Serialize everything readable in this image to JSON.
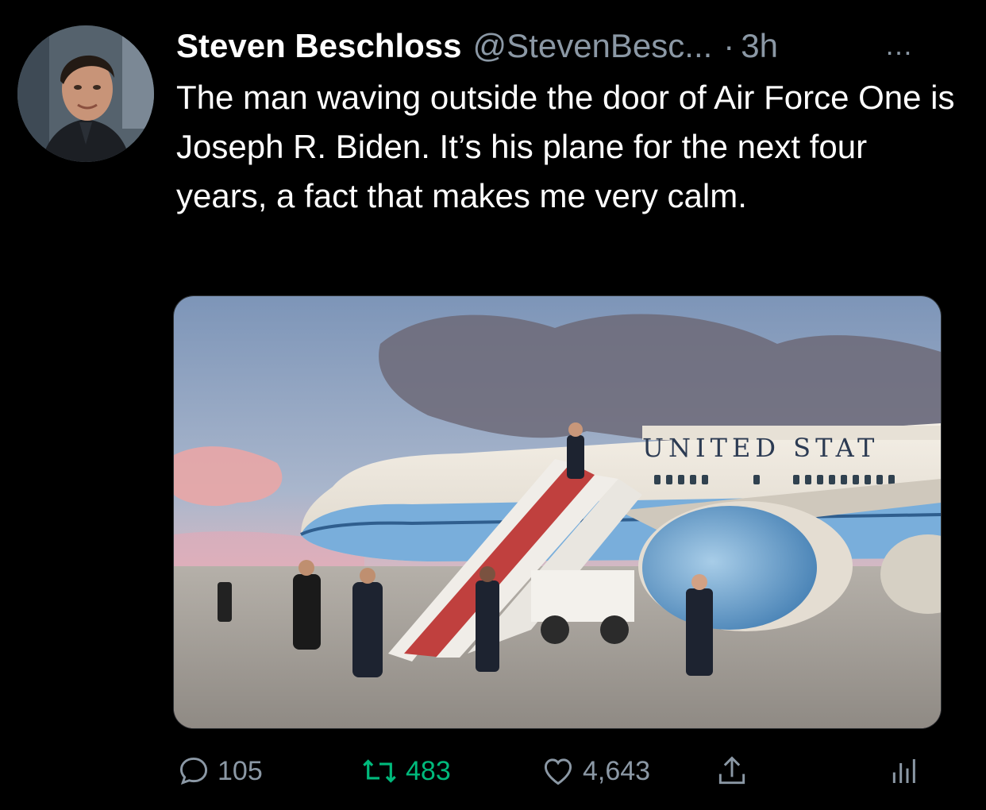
{
  "tweet": {
    "author_name": "Steven Beschloss",
    "handle": "@StevenBesc...",
    "separator": "·",
    "time": "3h",
    "more_icon": "…",
    "text": "The man waving outside the door of Air Force One is Joseph R. Biden. It’s his plane for the next four years, a fact that makes me very calm.",
    "image_text": "UNITED STAT"
  },
  "actions": {
    "replies": "105",
    "retweets": "483",
    "likes": "4,643",
    "share_icon": "share-icon",
    "analytics_icon": "analytics-icon"
  },
  "colors": {
    "background": "#000000",
    "secondary_text": "#8b98a5",
    "retweet_active": "#00ba7c"
  }
}
